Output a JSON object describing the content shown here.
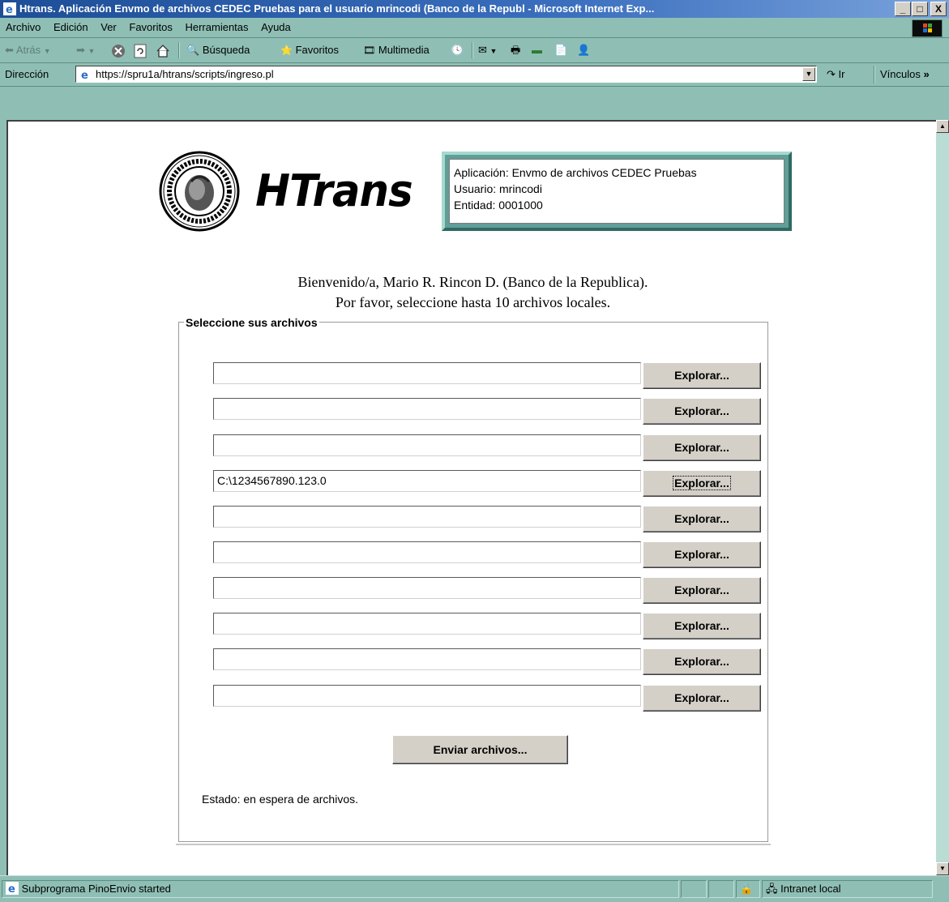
{
  "window": {
    "title": "Htrans. Aplicación Envmo de archivos CEDEC Pruebas para el usuario mrincodi (Banco de la Republ - Microsoft Internet Exp...",
    "controls": {
      "minimize": "_",
      "maximize": "□",
      "close": "X"
    }
  },
  "menubar": {
    "items": [
      "Archivo",
      "Edición",
      "Ver",
      "Favoritos",
      "Herramientas",
      "Ayuda"
    ]
  },
  "toolbar": {
    "back_label": "Atrás",
    "search_label": "Búsqueda",
    "favorites_label": "Favoritos",
    "media_label": "Multimedia"
  },
  "addressbar": {
    "label": "Dirección",
    "url": "https://spru1a/htrans/scripts/ingreso.pl",
    "go_label": "Ir",
    "links_label": "Vínculos"
  },
  "page": {
    "logo_text": "HTrans",
    "info": {
      "application": "Aplicación: Envmo de archivos CEDEC Pruebas",
      "user": "Usuario: mrincodi",
      "entity": "Entidad: 0001000"
    },
    "welcome_line1": "Bienvenido/a, Mario R. Rincon D. (Banco de la Republica).",
    "welcome_line2": "Por favor, seleccione hasta 10 archivos locales.",
    "fieldset_legend": "Seleccione sus archivos",
    "files": [
      {
        "value": "",
        "button": "Explorar..."
      },
      {
        "value": "",
        "button": "Explorar..."
      },
      {
        "value": "",
        "button": "Explorar..."
      },
      {
        "value": "C:\\1234567890.123.0",
        "button": "Explorar..."
      },
      {
        "value": "",
        "button": "Explorar..."
      },
      {
        "value": "",
        "button": "Explorar..."
      },
      {
        "value": "",
        "button": "Explorar..."
      },
      {
        "value": "",
        "button": "Explorar..."
      },
      {
        "value": "",
        "button": "Explorar..."
      },
      {
        "value": "",
        "button": "Explorar..."
      }
    ],
    "send_button": "Enviar archivos...",
    "status": "Estado: en espera de archivos."
  },
  "statusbar": {
    "message": "Subprograma PinoEnvio started",
    "zone": "Intranet local"
  },
  "colors": {
    "chrome": "#8fbfb4",
    "titlebar": "#1d4e97",
    "panel": "#5f9f97"
  }
}
